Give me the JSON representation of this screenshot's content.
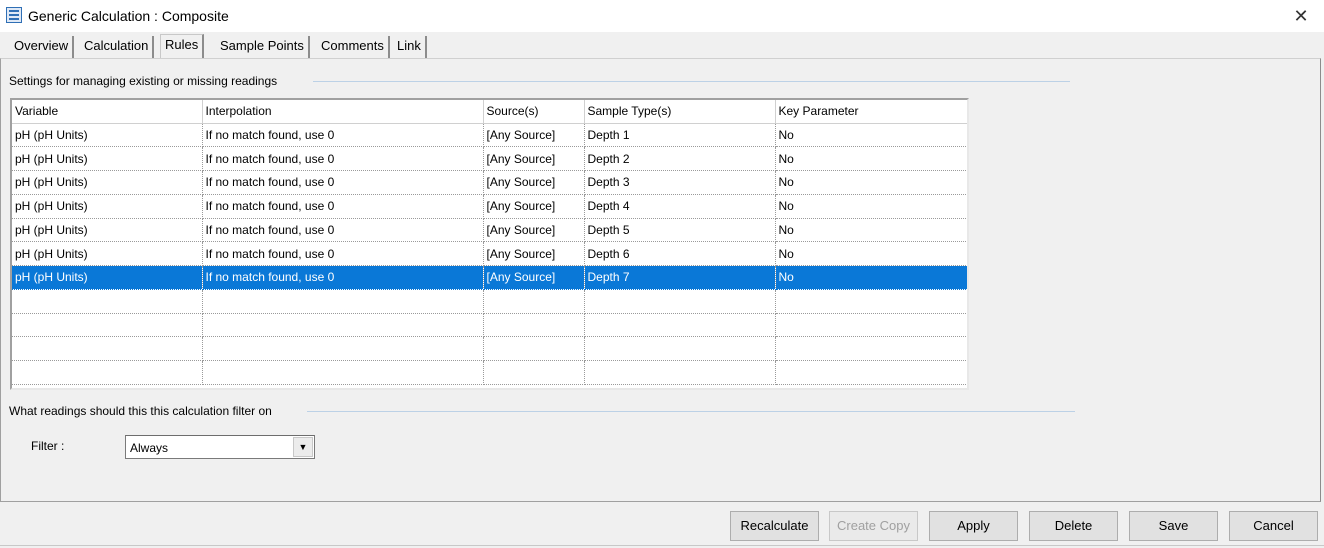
{
  "window": {
    "title": "Generic Calculation : Composite",
    "close_glyph": "✕"
  },
  "tabs": [
    {
      "label": "Overview"
    },
    {
      "label": "Calculation"
    },
    {
      "label": "Rules"
    },
    {
      "label": "Sample Points"
    },
    {
      "label": "Comments"
    },
    {
      "label": "Link"
    }
  ],
  "active_tab": "Rules",
  "rules_section": {
    "heading": "Settings for managing existing or missing readings",
    "columns": [
      "Variable",
      "Interpolation",
      "Source(s)",
      "Sample Type(s)",
      "Key Parameter"
    ],
    "rows": [
      [
        "pH (pH Units)",
        "If no match found, use 0",
        "[Any Source]",
        "Depth 1",
        "No"
      ],
      [
        "pH (pH Units)",
        "If no match found, use 0",
        "[Any Source]",
        "Depth 2",
        "No"
      ],
      [
        "pH (pH Units)",
        "If no match found, use 0",
        "[Any Source]",
        "Depth 3",
        "No"
      ],
      [
        "pH (pH Units)",
        "If no match found, use 0",
        "[Any Source]",
        "Depth 4",
        "No"
      ],
      [
        "pH (pH Units)",
        "If no match found, use 0",
        "[Any Source]",
        "Depth 5",
        "No"
      ],
      [
        "pH (pH Units)",
        "If no match found, use 0",
        "[Any Source]",
        "Depth 6",
        "No"
      ],
      [
        "pH (pH Units)",
        "If no match found, use 0",
        "[Any Source]",
        "Depth 7",
        "No"
      ]
    ],
    "selected_row": 7,
    "selection_color": "#0a78d7"
  },
  "filter_section": {
    "heading": "What readings should this this calculation filter on",
    "filter_label": "Filter :",
    "filter_value": "Always",
    "dropdown_glyph": "▼"
  },
  "buttons": {
    "recalculate": "Recalculate",
    "create_copy": "Create Copy",
    "apply": "Apply",
    "delete": "Delete",
    "save": "Save",
    "cancel": "Cancel"
  },
  "icons": {
    "app": "calculator-icon",
    "close": "close-icon",
    "dropdown": "chevron-down-icon"
  }
}
